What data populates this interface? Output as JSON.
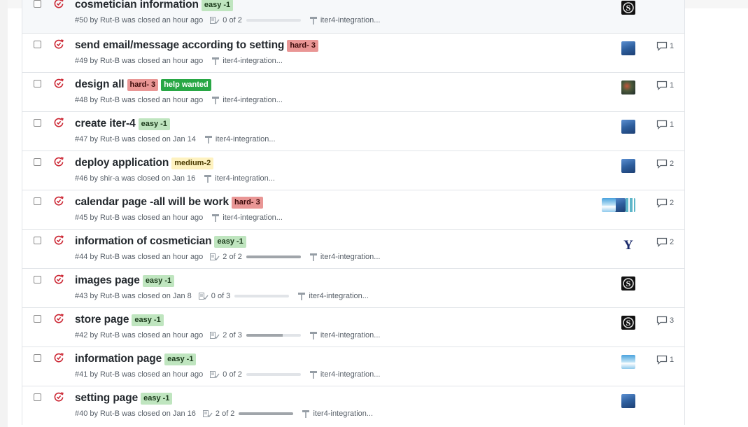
{
  "colors": {
    "closed_icon": "#cb2431",
    "label_easy_bg": "#bfe5bf",
    "label_hard_bg": "#e99695",
    "label_medium_bg": "#fef2c0",
    "label_help_bg": "#28a745"
  },
  "issues": [
    {
      "title": "cosmetician information",
      "labels": [
        {
          "text": "easy -1",
          "kind": "easy"
        }
      ],
      "number": "#50",
      "author": "Rut-B",
      "closed_text": "was closed an hour ago",
      "tasks": "0 of 2",
      "progress": 0,
      "milestone": "iter4-integration...",
      "avatars": [
        "s-icon"
      ],
      "comments": ""
    },
    {
      "title": "send email/message according to setting",
      "labels": [
        {
          "text": "hard- 3",
          "kind": "hard"
        }
      ],
      "number": "#49",
      "author": "Rut-B",
      "closed_text": "was closed an hour ago",
      "tasks": "",
      "progress": null,
      "milestone": "iter4-integration...",
      "avatars": [
        "blue"
      ],
      "comments": "1"
    },
    {
      "title": "design all",
      "labels": [
        {
          "text": "hard- 3",
          "kind": "hard"
        },
        {
          "text": "help wanted",
          "kind": "help"
        }
      ],
      "number": "#48",
      "author": "Rut-B",
      "closed_text": "was closed an hour ago",
      "tasks": "",
      "progress": null,
      "milestone": "iter4-integration...",
      "avatars": [
        "dark"
      ],
      "comments": "1"
    },
    {
      "title": "create iter-4",
      "labels": [
        {
          "text": "easy -1",
          "kind": "easy"
        }
      ],
      "number": "#47",
      "author": "Rut-B",
      "closed_text": "was closed on Jan 14",
      "tasks": "",
      "progress": null,
      "milestone": "iter4-integration...",
      "avatars": [
        "blue"
      ],
      "comments": "1"
    },
    {
      "title": "deploy application",
      "labels": [
        {
          "text": "medium-2",
          "kind": "medium"
        }
      ],
      "number": "#46",
      "author": "shir-a",
      "closed_text": "was closed on Jan 16",
      "tasks": "",
      "progress": null,
      "milestone": "iter4-integration...",
      "avatars": [
        "blue"
      ],
      "comments": "2"
    },
    {
      "title": "calendar page -all will be work",
      "labels": [
        {
          "text": "hard- 3",
          "kind": "hard"
        }
      ],
      "number": "#45",
      "author": "Rut-B",
      "closed_text": "was closed an hour ago",
      "tasks": "",
      "progress": null,
      "milestone": "iter4-integration...",
      "avatars": [
        "pixel",
        "blue",
        "sky"
      ],
      "comments": "2"
    },
    {
      "title": "information of cosmetician",
      "labels": [
        {
          "text": "easy -1",
          "kind": "easy"
        }
      ],
      "number": "#44",
      "author": "Rut-B",
      "closed_text": "was closed an hour ago",
      "tasks": "2 of 2",
      "progress": 1,
      "milestone": "iter4-integration...",
      "avatars": [
        "y-icon"
      ],
      "comments": "2"
    },
    {
      "title": "images page",
      "labels": [
        {
          "text": "easy -1",
          "kind": "easy"
        }
      ],
      "number": "#43",
      "author": "Rut-B",
      "closed_text": "was closed on Jan 8",
      "tasks": "0 of 3",
      "progress": 0,
      "milestone": "iter4-integration...",
      "avatars": [
        "s-icon"
      ],
      "comments": ""
    },
    {
      "title": "store page",
      "labels": [
        {
          "text": "easy -1",
          "kind": "easy"
        }
      ],
      "number": "#42",
      "author": "Rut-B",
      "closed_text": "was closed an hour ago",
      "tasks": "2 of 3",
      "progress": 0.67,
      "milestone": "iter4-integration...",
      "avatars": [
        "s-icon"
      ],
      "comments": "3"
    },
    {
      "title": "information page",
      "labels": [
        {
          "text": "easy -1",
          "kind": "easy"
        }
      ],
      "number": "#41",
      "author": "Rut-B",
      "closed_text": "was closed an hour ago",
      "tasks": "0 of 2",
      "progress": 0,
      "milestone": "iter4-integration...",
      "avatars": [
        "sky"
      ],
      "comments": "1"
    },
    {
      "title": "setting page",
      "labels": [
        {
          "text": "easy -1",
          "kind": "easy"
        }
      ],
      "number": "#40",
      "author": "Rut-B",
      "closed_text": "was closed on Jan 16",
      "tasks": "2 of 2",
      "progress": 1,
      "milestone": "iter4-integration...",
      "avatars": [
        "blue"
      ],
      "comments": ""
    }
  ]
}
